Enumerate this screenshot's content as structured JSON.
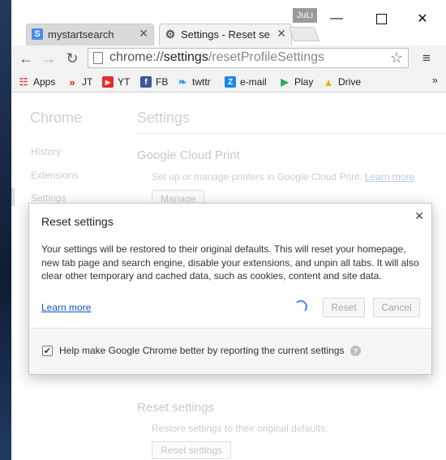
{
  "window": {
    "user_name": "JuLi",
    "minimize_icon": "minimize-icon",
    "maximize_icon": "maximize-icon",
    "close_icon": "close-icon"
  },
  "tabs": [
    {
      "title": "mystartsearch",
      "favicon": "S",
      "favicon_color": "#4a8af4"
    },
    {
      "title": "Settings - Reset settir",
      "favicon": "gear-icon"
    }
  ],
  "toolbar": {
    "url_scheme": "chrome://",
    "url_host": "settings",
    "url_path": "/resetProfileSettings",
    "back_icon": "back-arrow-icon",
    "forward_icon": "forward-arrow-icon",
    "reload_icon": "reload-icon",
    "star_icon": "bookmark-star-icon",
    "menu_icon": "menu-icon"
  },
  "bookmarks": [
    {
      "label": "Apps",
      "icon": "apps-grid-icon"
    },
    {
      "label": "JT",
      "icon": "jt-icon"
    },
    {
      "label": "YT",
      "icon": "youtube-icon"
    },
    {
      "label": "FB",
      "icon": "facebook-icon"
    },
    {
      "label": "twttr",
      "icon": "twitter-icon"
    },
    {
      "label": "e-mail",
      "icon": "zoho-icon"
    },
    {
      "label": "Play",
      "icon": "play-store-icon"
    },
    {
      "label": "Drive",
      "icon": "drive-icon"
    }
  ],
  "bookmarks_more": "»",
  "sidebar": {
    "title": "Chrome",
    "items": [
      "History",
      "Extensions",
      "Settings"
    ]
  },
  "main": {
    "title": "Settings",
    "sections": [
      {
        "title": "Google Cloud Print",
        "desc": "Set up or manage printers in Google Cloud Print.",
        "link": "Learn more",
        "button": "Manage"
      },
      {
        "title": "Reset settings",
        "desc": "Restore settings to their original defaults.",
        "button": "Reset settings"
      }
    ]
  },
  "dialog": {
    "title": "Reset settings",
    "body": "Your settings will be restored to their original defaults. This will reset your homepage, new tab page and search engine, disable your extensions, and unpin all tabs. It will also clear other temporary and cached data, such as cookies, content and site data.",
    "learn_more": "Learn more",
    "reset_button": "Reset",
    "cancel_button": "Cancel",
    "checkbox_label": "Help make Google Chrome better by reporting the current settings",
    "checkbox_checked": true
  },
  "colors": {
    "accent": "#4285f4",
    "link": "#1155cc"
  }
}
